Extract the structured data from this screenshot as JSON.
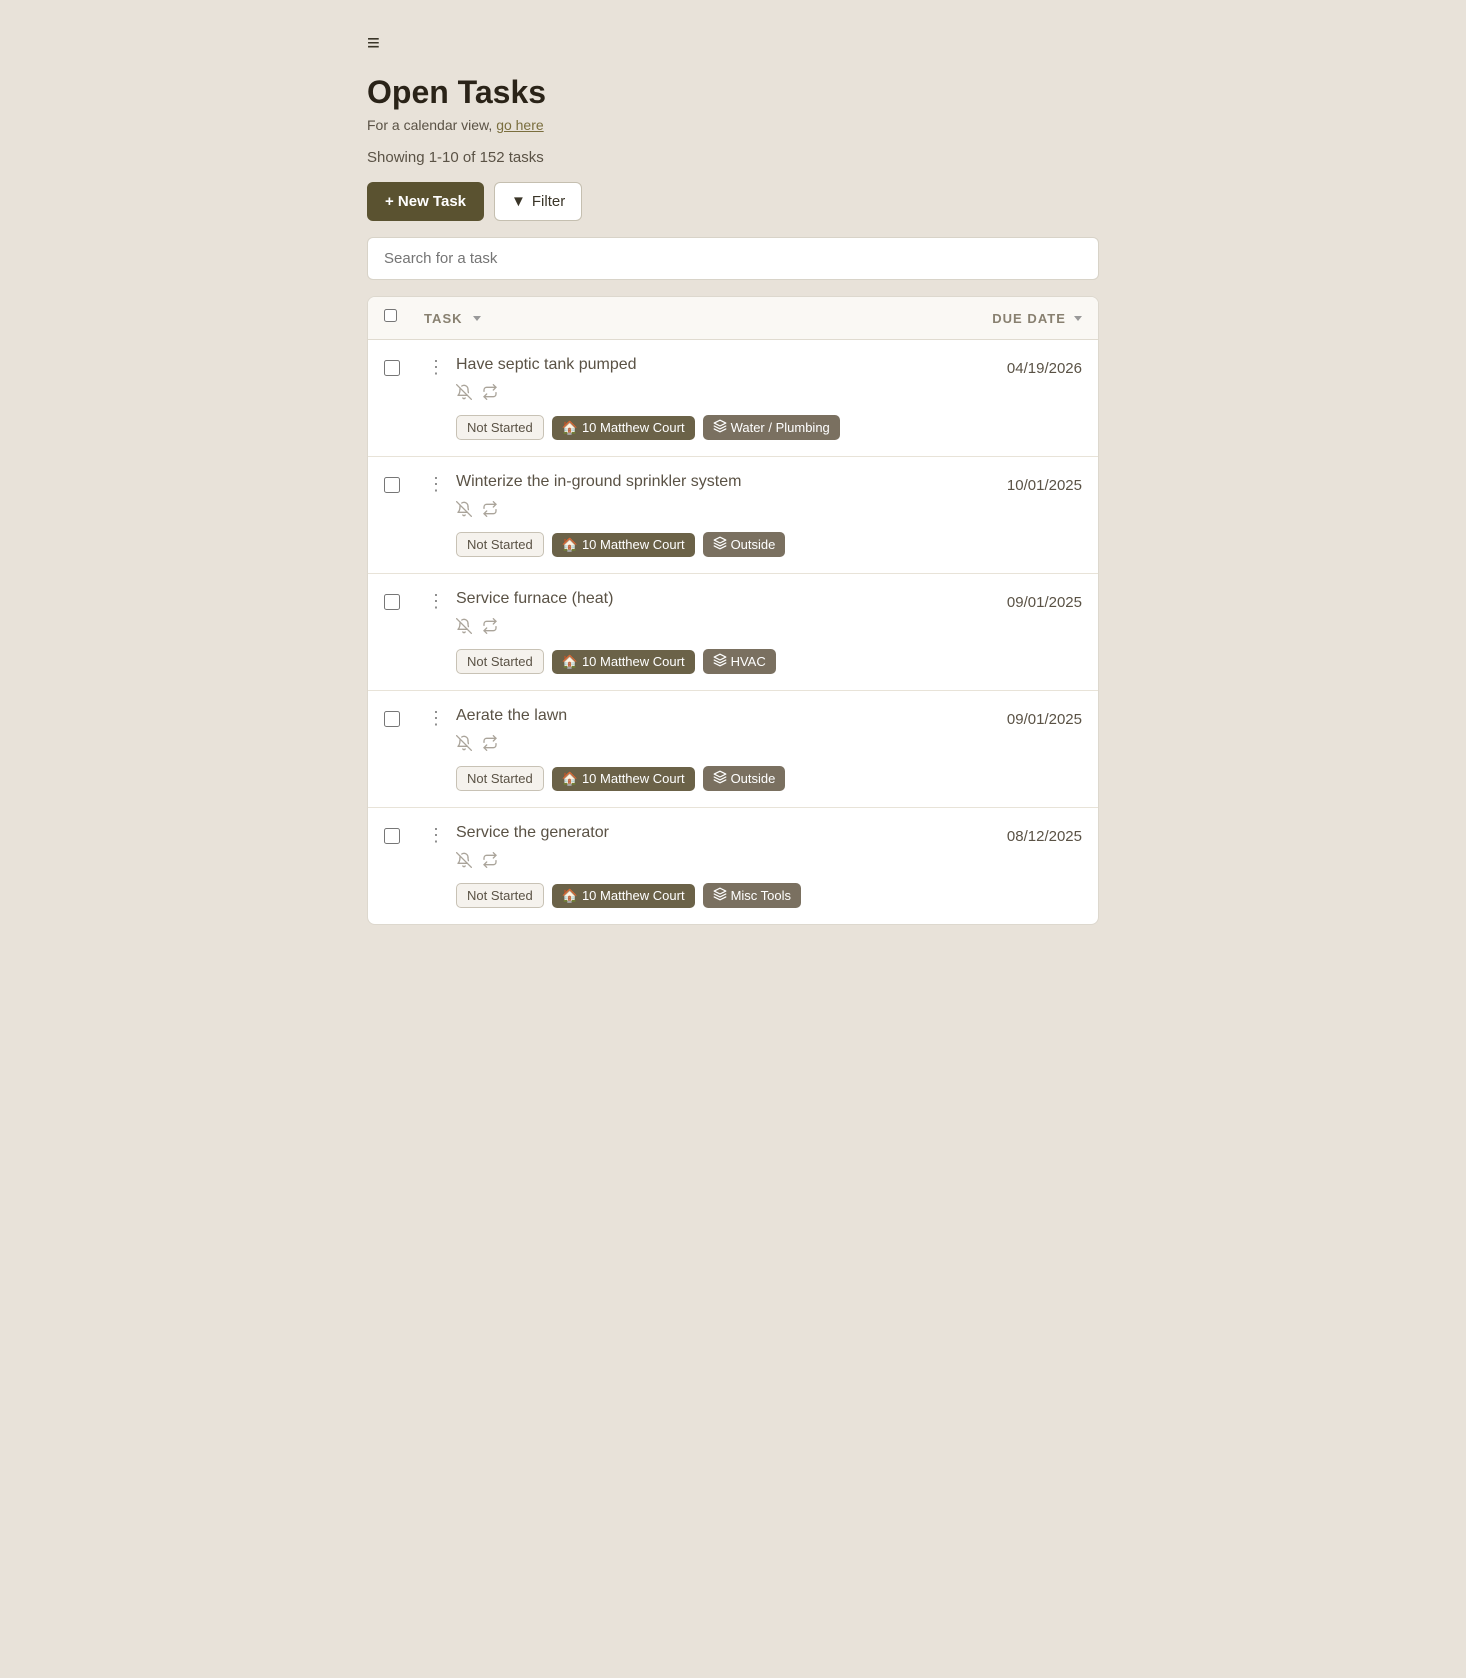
{
  "page": {
    "menu_icon": "≡",
    "title": "Open Tasks",
    "calendar_text": "For a calendar view,",
    "calendar_link": "go here",
    "showing_text": "Showing 1-10 of 152 tasks",
    "new_task_label": "+ New Task",
    "filter_label": "Filter",
    "search_placeholder": "Search for a task",
    "columns": {
      "task": "TASK",
      "due_date": "DUE DATE"
    }
  },
  "tasks": [
    {
      "id": 1,
      "title": "Have septic tank pumped",
      "status": "Not Started",
      "location": "10 Matthew Court",
      "category": "Water / Plumbing",
      "due_date": "04/19/2026"
    },
    {
      "id": 2,
      "title": "Winterize the in-ground sprinkler system",
      "status": "Not Started",
      "location": "10 Matthew Court",
      "category": "Outside",
      "due_date": "10/01/2025"
    },
    {
      "id": 3,
      "title": "Service furnace (heat)",
      "status": "Not Started",
      "location": "10 Matthew Court",
      "category": "HVAC",
      "due_date": "09/01/2025"
    },
    {
      "id": 4,
      "title": "Aerate the lawn",
      "status": "Not Started",
      "location": "10 Matthew Court",
      "category": "Outside",
      "due_date": "09/01/2025"
    },
    {
      "id": 5,
      "title": "Service the generator",
      "status": "Not Started",
      "location": "10 Matthew Court",
      "category": "Misc Tools",
      "due_date": "08/12/2025"
    }
  ]
}
